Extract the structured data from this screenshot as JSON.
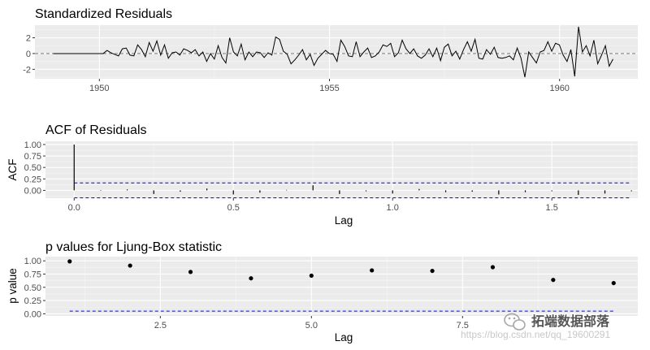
{
  "chart_data": [
    {
      "type": "line",
      "title": "Standardized Residuals",
      "xlabel": "",
      "ylabel": "",
      "xlim": [
        1948.6,
        1961.7
      ],
      "ylim": [
        -3.2,
        3.6
      ],
      "x_ticks": [
        1950,
        1955,
        1960
      ],
      "x_tick_labels": [
        "1950",
        "1955",
        "1960"
      ],
      "y_ticks": [
        -2,
        0,
        2
      ],
      "y_tick_labels": [
        "-2",
        "0",
        "2"
      ],
      "reference_line": 0,
      "grid": true,
      "series": [
        {
          "x_start": 1949.0,
          "x_step": 0.0833,
          "values": [
            0,
            0,
            0,
            0,
            0,
            0,
            0,
            0,
            0,
            0,
            0,
            0,
            0,
            0,
            0.4,
            0.1,
            -0.1,
            -0.3,
            0.6,
            0.7,
            -0.2,
            -0.3,
            1.1,
            0.5,
            -0.4,
            1.4,
            0.3,
            1.6,
            -0.2,
            1.1,
            -0.6,
            0.1,
            0.2,
            -0.2,
            0.6,
            0.4,
            0.1,
            0.5,
            -0.3,
            0.2,
            -1.0,
            0,
            -0.7,
            1.0,
            -0.5,
            -1.2,
            2.0,
            0.2,
            -0.3,
            1.2,
            -0.8,
            0.2,
            -0.4,
            0.2,
            0.1,
            -0.5,
            0.1,
            -0.2,
            2.1,
            1.8,
            0.3,
            -0.1,
            -1.3,
            -0.8,
            -0.2,
            0.5,
            -0.8,
            -0.1,
            -1.5,
            -0.6,
            -0.1,
            0.4,
            0,
            -0.1,
            -1.0,
            1.7,
            0.9,
            -0.3,
            -0.4,
            1.5,
            -0.4,
            0.2,
            0.7,
            -0.5,
            -0.3,
            0.2,
            1.1,
            0.9,
            1.3,
            -0.4,
            0.1,
            1.7,
            0.6,
            0,
            0.6,
            -0.3,
            -0.6,
            -0.2,
            0.6,
            -0.4,
            0.7,
            -0.9,
            0.8,
            1.2,
            -0.3,
            0.3,
            -0.7,
            0.5,
            1.5,
            0.3,
            1.8,
            -0.6,
            -0.7,
            0.5,
            -0.1,
            0.8,
            -0.5,
            -0.6,
            -0.5,
            -0.3,
            -0.8,
            0.7,
            -0.6,
            -3.0,
            0.2,
            -0.5,
            -1.2,
            0.2,
            0.4,
            1.5,
            0.3,
            1.3,
            1.1,
            -0.2,
            -1.0,
            0.5,
            -2.9,
            3.4,
            0.2,
            1.0,
            -0.3,
            1.7,
            -1.3,
            -0.2,
            1.0,
            -1.6,
            -0.7
          ],
          "color": "#000000"
        }
      ]
    },
    {
      "type": "bar",
      "title": "ACF of Residuals",
      "xlabel": "Lag",
      "ylabel": "ACF",
      "xlim": [
        -0.09,
        1.77
      ],
      "ylim": [
        -0.17,
        1.07
      ],
      "x_ticks": [
        0,
        0.5,
        1.0,
        1.5
      ],
      "x_tick_labels": [
        "0.0",
        "0.5",
        "1.0",
        "1.5"
      ],
      "y_ticks": [
        0,
        0.25,
        0.5,
        0.75,
        1.0
      ],
      "y_tick_labels": [
        "0.00",
        "0.25",
        "0.50",
        "0.75",
        "1.00"
      ],
      "confidence_bounds": [
        0.163,
        -0.163
      ],
      "grid": true,
      "lags": [
        0,
        0.0833,
        0.1667,
        0.25,
        0.3333,
        0.4167,
        0.5,
        0.5833,
        0.6667,
        0.75,
        0.8333,
        0.9167,
        1.0,
        1.0833,
        1.1667,
        1.25,
        1.3333,
        1.4167,
        1.5,
        1.5833,
        1.6667,
        1.75
      ],
      "values": [
        1.0,
        -0.01,
        0.02,
        -0.08,
        -0.03,
        0.04,
        -0.09,
        -0.05,
        0.01,
        0.11,
        -0.08,
        -0.02,
        -0.07,
        0.03,
        -0.04,
        -0.03,
        -0.09,
        -0.04,
        -0.02,
        -0.1,
        -0.07,
        -0.02
      ],
      "color": "#000000",
      "bound_color": "#0000ff"
    },
    {
      "type": "scatter",
      "title": "p values for Ljung-Box statistic",
      "xlabel": "Lag",
      "ylabel": "p value",
      "xlim": [
        0.6,
        10.4
      ],
      "ylim": [
        -0.04,
        1.08
      ],
      "x_ticks": [
        2.5,
        5.0,
        7.5
      ],
      "x_tick_labels": [
        "2.5",
        "5.0",
        "7.5"
      ],
      "y_ticks": [
        0,
        0.25,
        0.5,
        0.75,
        1.0
      ],
      "y_tick_labels": [
        "0.00",
        "0.25",
        "0.50",
        "0.75",
        "1.00"
      ],
      "threshold": 0.05,
      "grid": true,
      "x": [
        1,
        2,
        3,
        4,
        5,
        6,
        7,
        8,
        9,
        10
      ],
      "y": [
        0.99,
        0.91,
        0.79,
        0.67,
        0.72,
        0.82,
        0.81,
        0.88,
        0.64,
        0.58
      ],
      "color": "#000000",
      "threshold_color": "#0000ff"
    }
  ],
  "watermark": {
    "brand": "拓端数据部落",
    "url": "https://blog.csdn.net/qq_19600291"
  }
}
